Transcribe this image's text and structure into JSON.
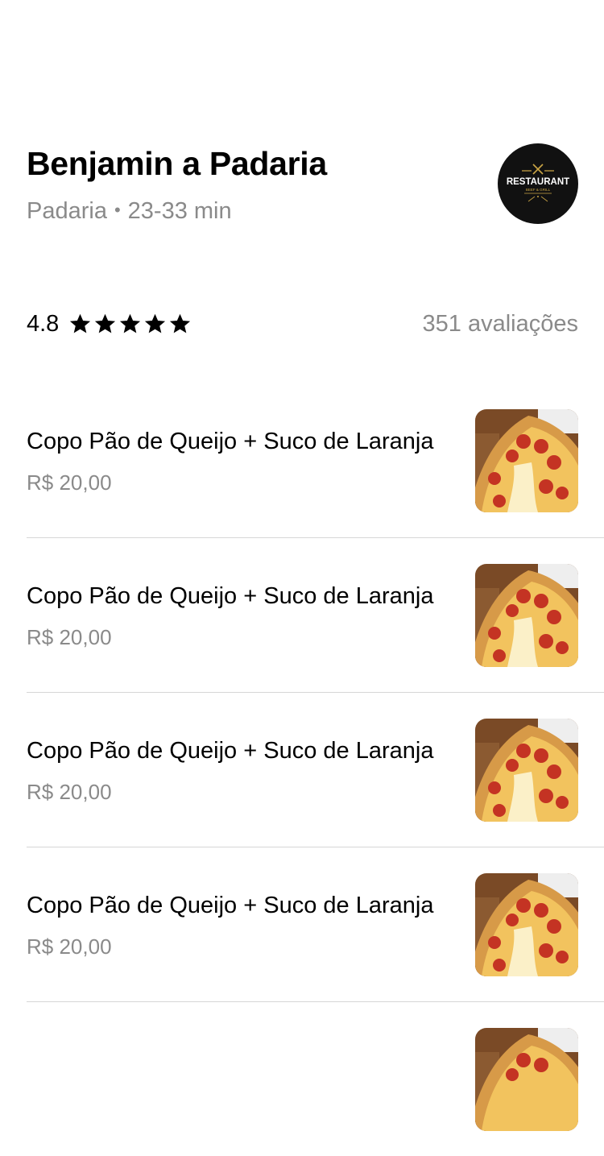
{
  "store": {
    "name": "Benjamin a Padaria",
    "category": "Padaria",
    "separator": "•",
    "delivery_time": "23-33 min",
    "logo": {
      "icon": "restaurant-logo",
      "text": "RESTAURANT",
      "subtext": "BEEF & GRILL"
    }
  },
  "rating": {
    "value": "4.8",
    "stars": 5,
    "reviews": "351 avaliações"
  },
  "menu": {
    "items": [
      {
        "name": "Copo Pão de Queijo + Suco de Laranja",
        "price": "R$ 20,00",
        "image": "pizza-photo"
      },
      {
        "name": "Copo Pão de Queijo + Suco de Laranja",
        "price": "R$ 20,00",
        "image": "pizza-photo"
      },
      {
        "name": "Copo Pão de Queijo + Suco de Laranja",
        "price": "R$ 20,00",
        "image": "pizza-photo"
      },
      {
        "name": "Copo Pão de Queijo + Suco de Laranja",
        "price": "R$ 20,00",
        "image": "pizza-photo"
      },
      {
        "name": "",
        "price": "",
        "image": "pizza-photo"
      }
    ]
  },
  "colors": {
    "text": "#000000",
    "muted": "#8a8a8a",
    "divider": "#d6d6d6",
    "logo_bg": "#111111"
  }
}
